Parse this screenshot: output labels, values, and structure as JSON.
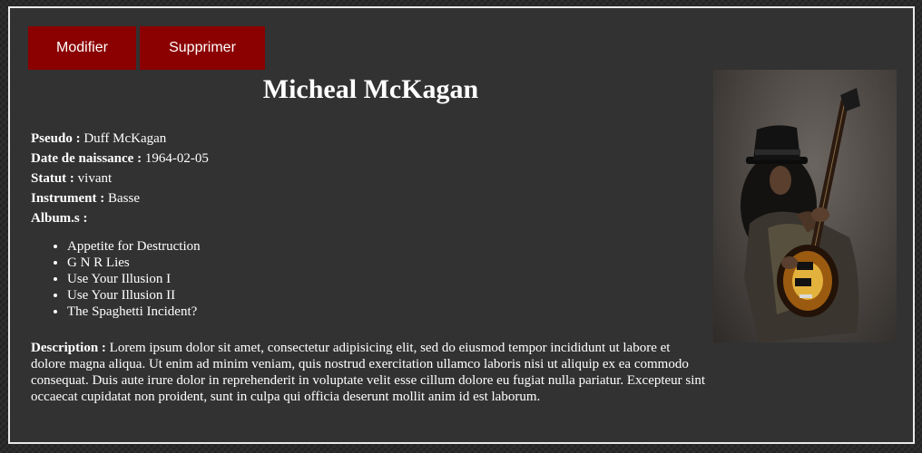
{
  "actions": {
    "modifier_label": "Modifier",
    "supprimer_label": "Supprimer"
  },
  "artist": {
    "name": "Micheal McKagan",
    "fields": [
      {
        "label": "Pseudo :",
        "value": "Duff McKagan"
      },
      {
        "label": "Date de naissance :",
        "value": "1964-02-05"
      },
      {
        "label": "Statut :",
        "value": "vivant"
      },
      {
        "label": "Instrument :",
        "value": "Basse"
      },
      {
        "label": "Album.s :",
        "value": ""
      }
    ],
    "albums": [
      "Appetite for Destruction",
      "G N R Lies",
      "Use Your Illusion I",
      "Use Your Illusion II",
      "The Spaghetti Incident?"
    ],
    "description_label": "Description :",
    "description": "Lorem ipsum dolor sit amet, consectetur adipisicing elit, sed do eiusmod tempor incididunt ut labore et dolore magna aliqua. Ut enim ad minim veniam, quis nostrud exercitation ullamco laboris nisi ut aliquip ex ea commodo consequat. Duis aute irure dolor in reprehenderit in voluptate velit esse cillum dolore eu fugiat nulla pariatur. Excepteur sint occaecat cupidatat non proident, sunt in culpa qui officia deserunt mollit anim id est laborum."
  },
  "photo": {
    "subject": "guitarist with top hat and sunburst electric guitar"
  },
  "colors": {
    "button_bg": "#8b0000",
    "card_bg": "#323232",
    "border": "#e9e9e9"
  }
}
